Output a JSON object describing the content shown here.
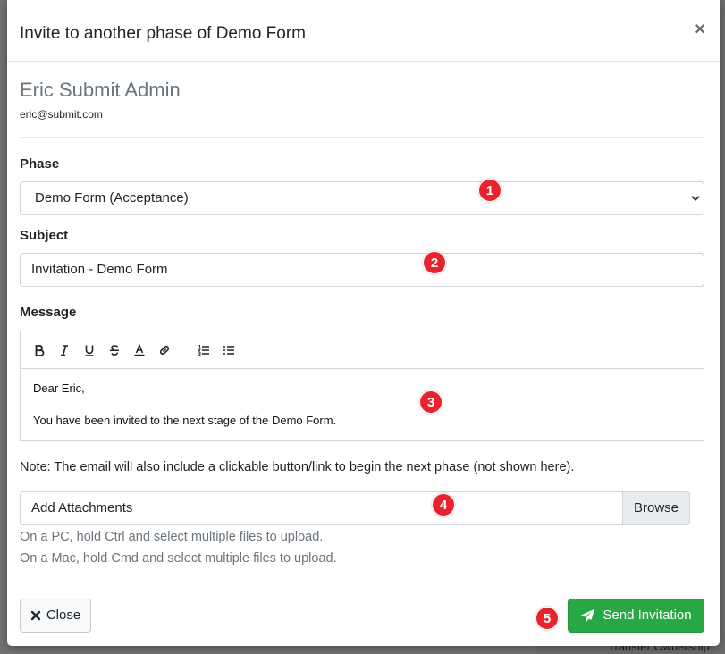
{
  "modal": {
    "title": "Invite to another phase of Demo Form",
    "close_glyph": "×"
  },
  "user": {
    "name": "Eric Submit Admin",
    "email": "eric@submit.com"
  },
  "form": {
    "phase_label": "Phase",
    "phase_value": "Demo Form (Acceptance)",
    "subject_label": "Subject",
    "subject_value": "Invitation - Demo Form",
    "message_label": "Message",
    "message_lines": [
      "Dear Eric,",
      "You have been invited to the next stage of the Demo Form."
    ],
    "toolbar": [
      "bold-icon",
      "italic-icon",
      "underline-icon",
      "strikethrough-icon",
      "text-color-icon",
      "link-icon",
      "ordered-list-icon",
      "bullet-list-icon"
    ],
    "note": "Note: The email will also include a clickable button/link to begin the next phase (not shown here).",
    "attachments_placeholder": "Add Attachments",
    "browse_label": "Browse",
    "hint_pc": "On a PC, hold Ctrl and select multiple files to upload.",
    "hint_mac": "On a Mac, hold Cmd and select multiple files to upload."
  },
  "footer": {
    "close_label": "Close",
    "send_label": "Send Invitation"
  },
  "badges": [
    "1",
    "2",
    "3",
    "4",
    "5"
  ],
  "colors": {
    "badge": "#e9232d",
    "send_button": "#28a745",
    "muted_text": "#6c757d"
  },
  "background": {
    "partial_text": "Transfer Ownership"
  }
}
